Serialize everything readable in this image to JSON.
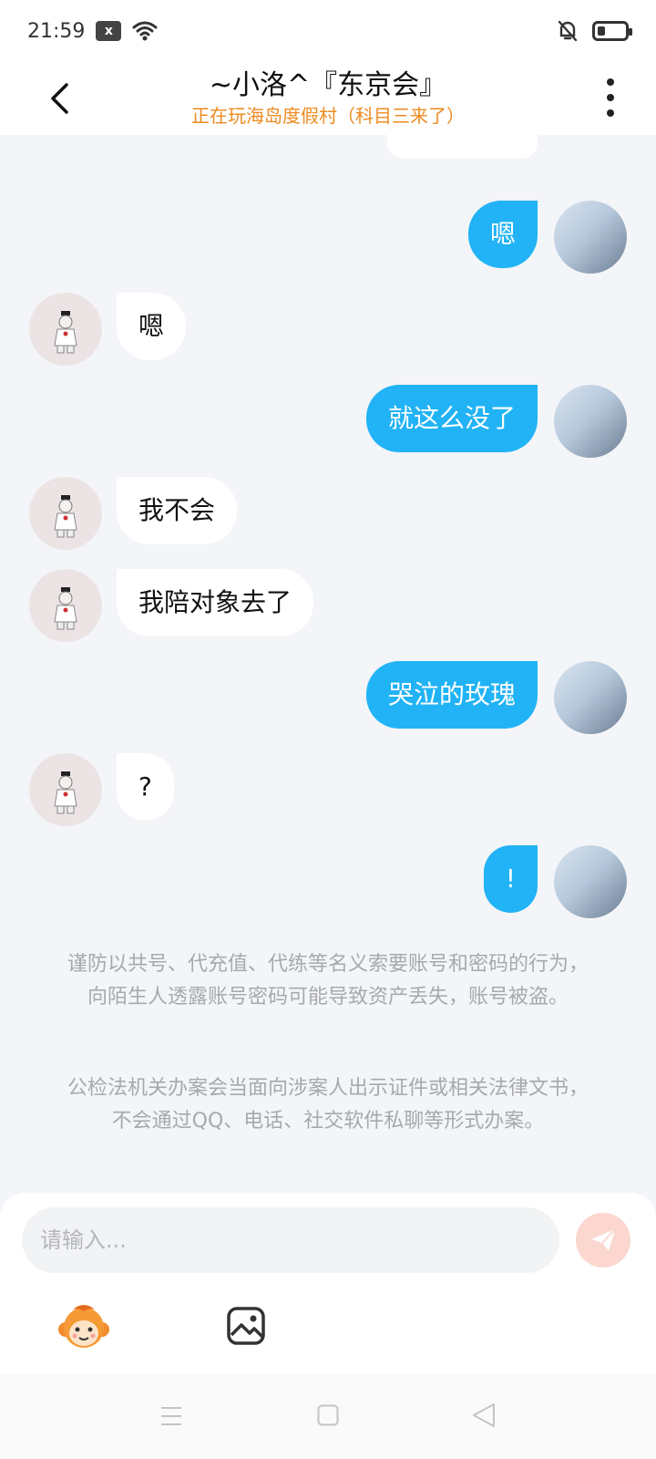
{
  "status_bar": {
    "time": "21:59",
    "notification_badge": "x"
  },
  "header": {
    "title": "~小洛^『东京会』",
    "subtitle": "正在玩海岛度假村（科目三来了）"
  },
  "messages": [
    {
      "side": "right",
      "text": "嗯"
    },
    {
      "side": "left",
      "text": "嗯"
    },
    {
      "side": "right",
      "text": "就这么没了"
    },
    {
      "side": "left",
      "text": "我不会"
    },
    {
      "side": "left",
      "text": "我陪对象去了"
    },
    {
      "side": "right",
      "text": "哭泣的玫瑰"
    },
    {
      "side": "left",
      "text": "?"
    },
    {
      "side": "right",
      "text": "!"
    }
  ],
  "notices": [
    "谨防以共号、代充值、代练等名义索要账号和密码的行为，向陌生人透露账号密码可能导致资产丢失，账号被盗。",
    "公检法机关办案会当面向涉案人出示证件或相关法律文书，不会通过QQ、电话、社交软件私聊等形式办案。"
  ],
  "input": {
    "placeholder": "请输入..."
  },
  "colors": {
    "self_bubble": "#21b3f5",
    "other_bubble": "#ffffff",
    "subtitle": "#ee8a1f",
    "send_button": "#fbd7cf"
  },
  "icons": {
    "back": "chevron-left-icon",
    "more": "more-vertical-icon",
    "send": "paper-plane-icon",
    "emoji": "monkey-emoji-icon",
    "image": "image-icon"
  }
}
